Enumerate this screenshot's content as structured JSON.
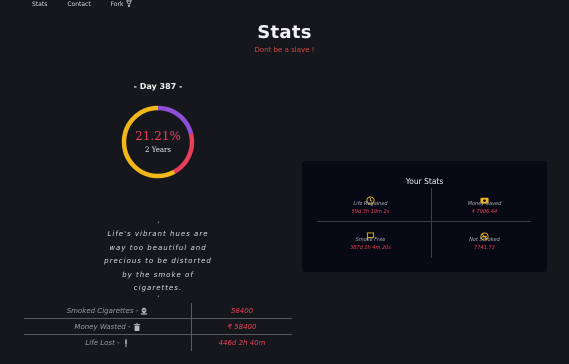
{
  "nav": {
    "items": [
      "Stats",
      "Contact",
      "Fork"
    ]
  },
  "header": {
    "title": "Stats",
    "subtitle": "Dont be a slave !"
  },
  "progress": {
    "day_label": "- Day 387 -",
    "percent_text": "21.21%",
    "percent": 21.21,
    "duration": "2 Years",
    "colors": {
      "purple": "#8d4fd6",
      "red": "#e8405a",
      "yellow": "#f2b81a"
    }
  },
  "quote": {
    "lines": [
      "Life's vibrant hues are",
      "way too beautiful and",
      "precious to be distorted",
      "by the smoke of",
      "cigarettes."
    ]
  },
  "summary": {
    "rows": [
      {
        "label": "Smoked Cigarettes -",
        "icon": "skull-icon",
        "value": "58400"
      },
      {
        "label": "Money Wasted -",
        "icon": "trash-icon",
        "value": "₹ 58400"
      },
      {
        "label": "Life Lost -",
        "icon": "exclamation-icon",
        "value": "446d 2h 40m"
      }
    ]
  },
  "your_stats": {
    "title": "Your Stats",
    "cells": [
      {
        "label": "Life Regained",
        "value": "59d 3h 19m 2s",
        "icon": "clock-icon",
        "icon_color": "#f2b81a"
      },
      {
        "label": "Money Saved",
        "value": "₹ 7906.44",
        "icon": "wallet-icon",
        "icon_color": "#f2b81a"
      },
      {
        "label": "Smoke Free",
        "value": "387d 2h 4m 20s",
        "icon": "flag-icon",
        "icon_color": "#f2b81a"
      },
      {
        "label": "Not Smoked",
        "value": "7741.73",
        "icon": "no-smoking-icon",
        "icon_color": "#f2b81a"
      }
    ]
  }
}
